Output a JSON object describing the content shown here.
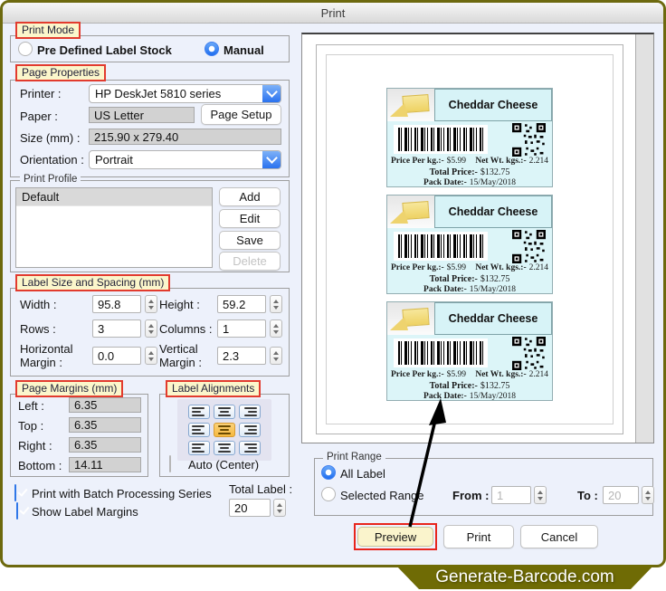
{
  "window": {
    "title": "Print"
  },
  "print_mode": {
    "label": "Print Mode",
    "predefined_label": "Pre Defined Label Stock",
    "manual_label": "Manual",
    "selected": "Manual"
  },
  "page_properties": {
    "label": "Page Properties",
    "printer_label": "Printer :",
    "printer_value": "HP DeskJet 5810 series",
    "paper_label": "Paper :",
    "paper_value": "US Letter",
    "page_setup_label": "Page Setup",
    "size_label": "Size (mm) :",
    "size_value": "215.90 x 279.40",
    "orientation_label": "Orientation :",
    "orientation_value": "Portrait"
  },
  "print_profile": {
    "label": "Print Profile",
    "items": {
      "first": "Default"
    },
    "add_label": "Add",
    "edit_label": "Edit",
    "save_label": "Save",
    "delete_label": "Delete"
  },
  "label_size": {
    "label": "Label Size and Spacing (mm)",
    "width_label": "Width :",
    "width": "95.8",
    "height_label": "Height :",
    "height": "59.2",
    "rows_label": "Rows :",
    "rows": "3",
    "columns_label": "Columns :",
    "columns": "1",
    "hmargin_label": "Horizontal Margin :",
    "hmargin": "0.0",
    "vmargin_label": "Vertical Margin :",
    "vmargin": "2.3"
  },
  "page_margins": {
    "label": "Page Margins (mm)",
    "left_label": "Left :",
    "left": "6.35",
    "top_label": "Top :",
    "top": "6.35",
    "right_label": "Right :",
    "right": "6.35",
    "bottom_label": "Bottom :",
    "bottom": "14.11"
  },
  "label_alignments": {
    "label": "Label Alignments",
    "selected": "middle-center",
    "auto_center_label": "Auto (Center)",
    "auto_center_checked": false
  },
  "options": {
    "batch_label": "Print with Batch Processing Series",
    "show_margins_label": "Show Label Margins",
    "total_label": "Total Label :",
    "total_value": "20"
  },
  "preview": {
    "count": 3,
    "card": {
      "title": "Cheddar Cheese",
      "price_label": "Price Per kg.:-",
      "price_value": "$5.99",
      "net_label": "Net Wt. kgs.:-",
      "net_value": "2.214",
      "total_label": "Total Price:-",
      "total_value": "$132.75",
      "date_label": "Pack Date:-",
      "date_value": "15/May/2018"
    }
  },
  "print_range": {
    "label": "Print Range",
    "all_label": "All Label",
    "selected_range_label": "Selected Range",
    "selected": "All Label",
    "from_label": "From :",
    "from_value": "1",
    "to_label": "To :",
    "to_value": "20"
  },
  "actions": {
    "preview_label": "Preview",
    "print_label": "Print",
    "cancel_label": "Cancel"
  },
  "branding": {
    "site": "Generate-Barcode.com"
  },
  "colors": {
    "accent_blue": "#2a72ef",
    "tag_yellow": "#fbf6cb",
    "tag_red_border": "#e23b2e",
    "olive": "#6d690e",
    "card_cyan": "#dcf5f8"
  }
}
